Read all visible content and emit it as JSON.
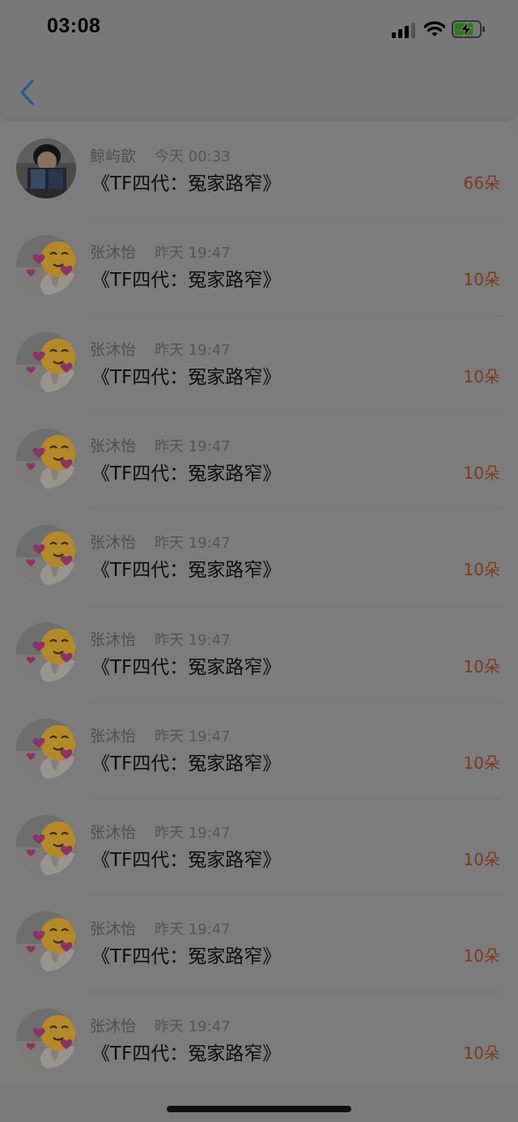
{
  "status_bar": {
    "time": "03:08",
    "icons": [
      "cellular-signal-icon",
      "wifi-icon",
      "battery-charging-icon"
    ]
  },
  "nav": {
    "back_icon": "chevron-left-icon",
    "accent_color": "#2a5b8a"
  },
  "colors": {
    "amount": "#7d3a1f",
    "title": "#0e0e0e",
    "meta": "#555555"
  },
  "rows": [
    {
      "name": "鲸屿歆",
      "time": "今天 00:33",
      "title": "《TF四代：冤家路窄》",
      "amount": "66朵",
      "avatar": "person-photo"
    },
    {
      "name": "张沐怡",
      "time": "昨天 19:47",
      "title": "《TF四代：冤家路窄》",
      "amount": "10朵",
      "avatar": "emoji-photo"
    },
    {
      "name": "张沐怡",
      "time": "昨天 19:47",
      "title": "《TF四代：冤家路窄》",
      "amount": "10朵",
      "avatar": "emoji-photo"
    },
    {
      "name": "张沐怡",
      "time": "昨天 19:47",
      "title": "《TF四代：冤家路窄》",
      "amount": "10朵",
      "avatar": "emoji-photo"
    },
    {
      "name": "张沐怡",
      "time": "昨天 19:47",
      "title": "《TF四代：冤家路窄》",
      "amount": "10朵",
      "avatar": "emoji-photo"
    },
    {
      "name": "张沐怡",
      "time": "昨天 19:47",
      "title": "《TF四代：冤家路窄》",
      "amount": "10朵",
      "avatar": "emoji-photo"
    },
    {
      "name": "张沐怡",
      "time": "昨天 19:47",
      "title": "《TF四代：冤家路窄》",
      "amount": "10朵",
      "avatar": "emoji-photo"
    },
    {
      "name": "张沐怡",
      "time": "昨天 19:47",
      "title": "《TF四代：冤家路窄》",
      "amount": "10朵",
      "avatar": "emoji-photo"
    },
    {
      "name": "张沐怡",
      "time": "昨天 19:47",
      "title": "《TF四代：冤家路窄》",
      "amount": "10朵",
      "avatar": "emoji-photo"
    },
    {
      "name": "张沐怡",
      "time": "昨天 19:47",
      "title": "《TF四代：冤家路窄》",
      "amount": "10朵",
      "avatar": "emoji-photo"
    }
  ]
}
